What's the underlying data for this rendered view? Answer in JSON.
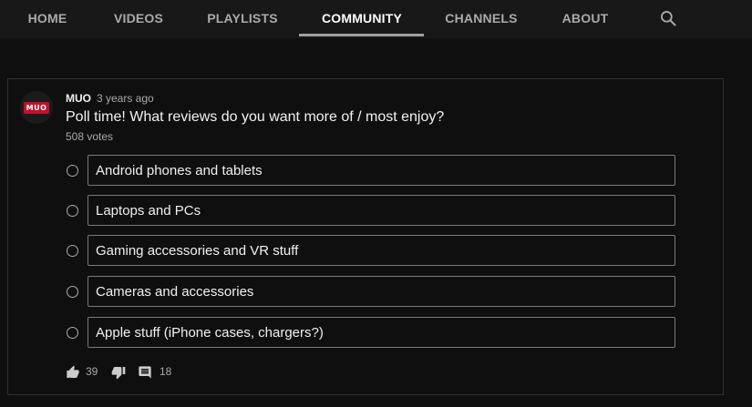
{
  "tabs": [
    {
      "label": "HOME"
    },
    {
      "label": "VIDEOS"
    },
    {
      "label": "PLAYLISTS"
    },
    {
      "label": "COMMUNITY",
      "active": true
    },
    {
      "label": "CHANNELS"
    },
    {
      "label": "ABOUT"
    }
  ],
  "search_icon": "search-icon",
  "post": {
    "avatar_text": "MUO",
    "author": "MUO",
    "time": "3 years ago",
    "text": "Poll time! What reviews do you want more of / most enjoy?",
    "votes": "508 votes",
    "options": [
      {
        "label": "Android phones and tablets"
      },
      {
        "label": "Laptops and PCs"
      },
      {
        "label": "Gaming accessories and VR stuff"
      },
      {
        "label": "Cameras and accessories"
      },
      {
        "label": "Apple stuff (iPhone cases, chargers?)"
      }
    ],
    "likes": "39",
    "comments": "18"
  },
  "colors": {
    "background": "#0f0f0f",
    "tabbar": "#181818",
    "text": "#f1f1f1",
    "secondary_text": "#aaaaaa",
    "brand_red": "#c4102b"
  },
  "icons": {
    "like": "thumbs-up-icon",
    "dislike": "thumbs-down-icon",
    "comment": "comment-icon"
  }
}
